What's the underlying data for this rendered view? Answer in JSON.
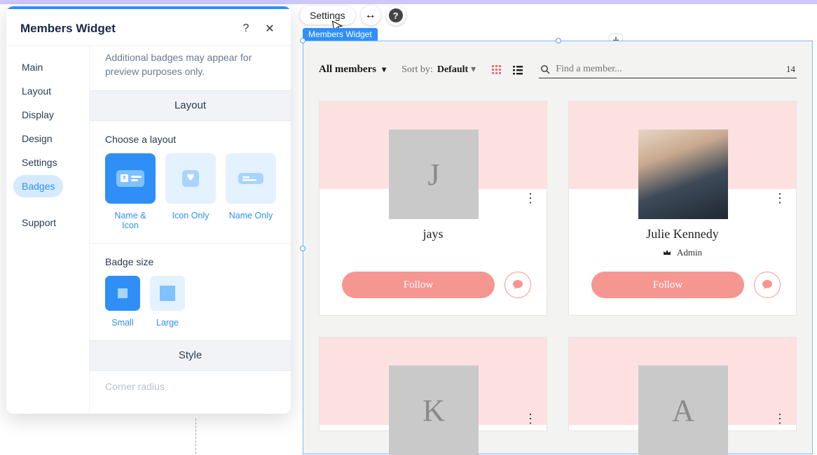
{
  "topPills": {
    "settings": "Settings"
  },
  "panel": {
    "title": "Members Widget",
    "side": {
      "main": "Main",
      "layout": "Layout",
      "display": "Display",
      "design": "Design",
      "settings": "Settings",
      "badges": "Badges",
      "support": "Support"
    },
    "hint": "Additional badges may appear for preview purposes only.",
    "layoutHeader": "Layout",
    "chooseLayout": "Choose a layout",
    "layoutOpts": {
      "nameIcon": "Name & Icon",
      "iconOnly": "Icon Only",
      "nameOnly": "Name Only"
    },
    "badgeSize": "Badge size",
    "sizeOpts": {
      "small": "Small",
      "large": "Large"
    },
    "styleHeader": "Style",
    "cornerRadius": "Corner radius"
  },
  "canvas": {
    "chip": "Members Widget",
    "allMembers": "All members",
    "sortBy": "Sort by:",
    "sortVal": "Default",
    "searchPlaceholder": "Find a member...",
    "count": "14",
    "follow": "Follow",
    "admin": "Admin",
    "members": [
      {
        "initial": "J",
        "name": "jays",
        "photo": false,
        "role": null
      },
      {
        "initial": "",
        "name": "Julie Kennedy",
        "photo": true,
        "role": "Admin"
      },
      {
        "initial": "K",
        "name": "",
        "photo": false,
        "role": null
      },
      {
        "initial": "A",
        "name": "",
        "photo": false,
        "role": null
      }
    ]
  }
}
